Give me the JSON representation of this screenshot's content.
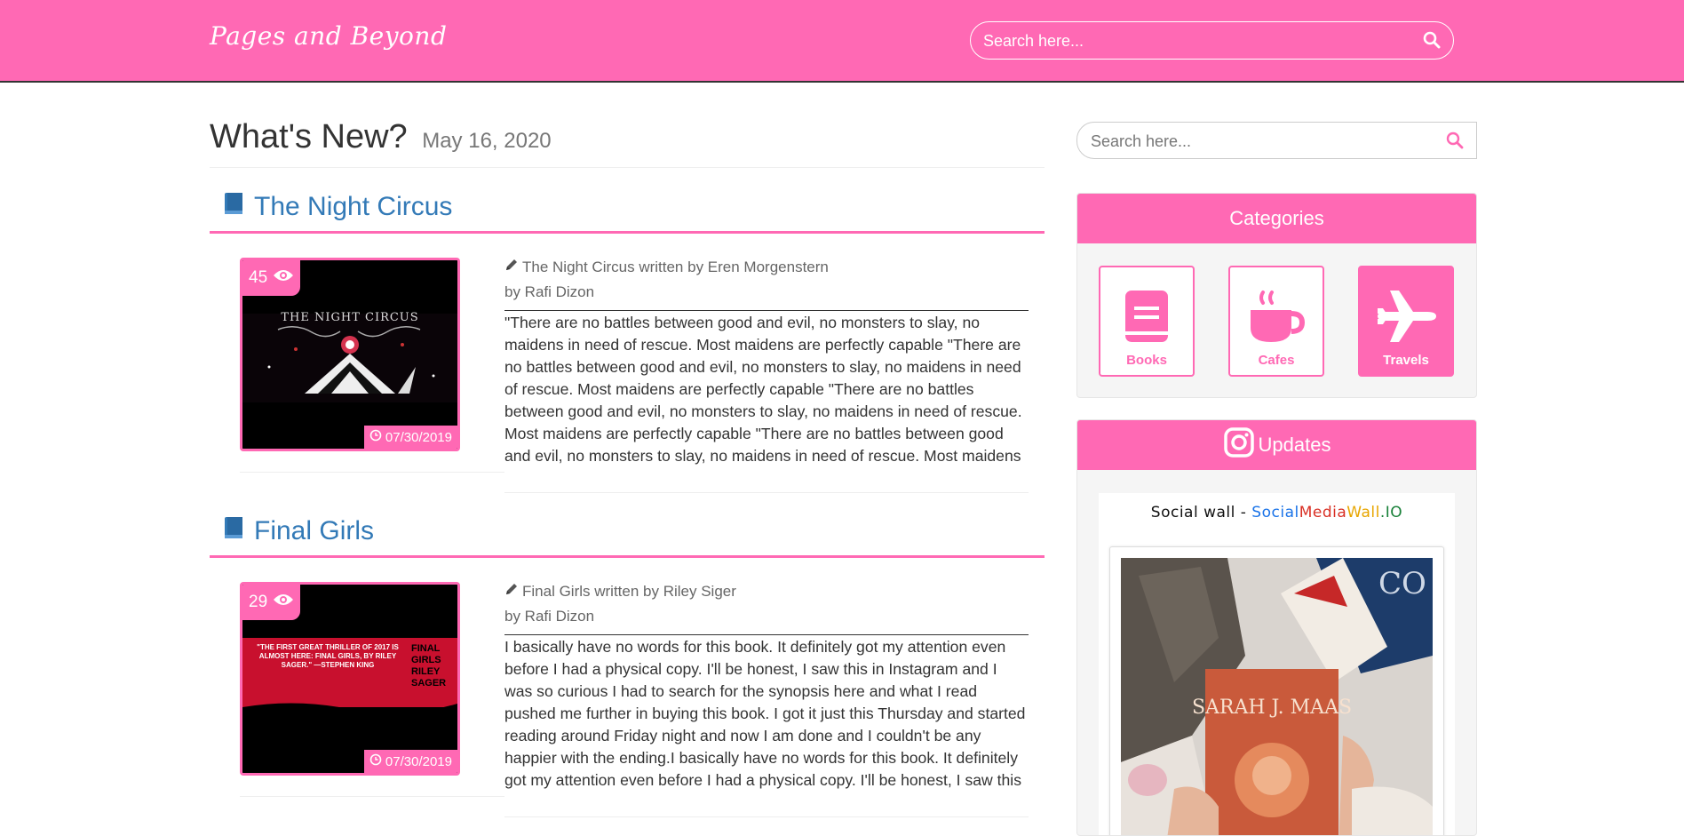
{
  "header": {
    "brand": "Pages and Beyond",
    "search_placeholder": "Search here..."
  },
  "main": {
    "heading": "What's New?",
    "date": "May 16, 2020",
    "posts": [
      {
        "title": "The Night Circus",
        "views": "45",
        "date": "07/30/2019",
        "cover_text": "THE NIGHT CIRCUS",
        "byline": "The Night Circus written by Eren Morgenstern",
        "author": "by Rafi Dizon",
        "excerpt": "\"There are no battles between good and evil, no monsters to slay, no maidens in need of rescue. Most maidens are perfectly capable \"There are no battles between good and evil, no monsters to slay, no maidens in need of rescue. Most maidens are perfectly capable \"There are no battles between good and evil, no monsters to slay, no maidens in need of rescue. Most maidens are perfectly capable \"There are no battles between good and evil, no monsters to slay, no maidens in need of rescue. Most maidens"
      },
      {
        "title": "Final Girls",
        "views": "29",
        "date": "07/30/2019",
        "cover_quote": "\"THE FIRST GREAT THRILLER OF 2017 IS ALMOST HERE: FINAL GIRLS, BY RILEY SAGER.\" —STEPHEN KING",
        "cover_side": "FINAL GIRLS RILEY SAGER",
        "byline": "Final Girls written by Riley Siger",
        "author": "by Rafi Dizon",
        "excerpt": "I basically have no words for this book. It definitely got my attention even before I had a physical copy. I'll be honest, I saw this in Instagram and I was so curious I had to search for the synopsis here and what I read pushed me further in buying this book. I got it just this Thursday and started reading around Friday night and now I am done and I couldn't be any happier with the ending.I basically have no words for this book. It definitely got my attention even before I had a physical copy. I'll be honest, I saw this"
      }
    ]
  },
  "sidebar": {
    "search_placeholder": "Search here...",
    "categories_title": "Categories",
    "categories": [
      {
        "label": "Books",
        "icon": "book-icon"
      },
      {
        "label": "Cafes",
        "icon": "coffee-cup-icon"
      },
      {
        "label": "Travels",
        "icon": "plane-icon",
        "active": true
      }
    ],
    "updates_title": "Updates",
    "social_wall_prefix": "Social wall - ",
    "social_brand": [
      "S",
      "ocial",
      "M",
      "edia",
      "W",
      "all",
      ".IO"
    ],
    "photo_book_author": "SARAH J. MAAS"
  },
  "colors": {
    "accent": "#ff69b4",
    "link": "#337ab7"
  }
}
